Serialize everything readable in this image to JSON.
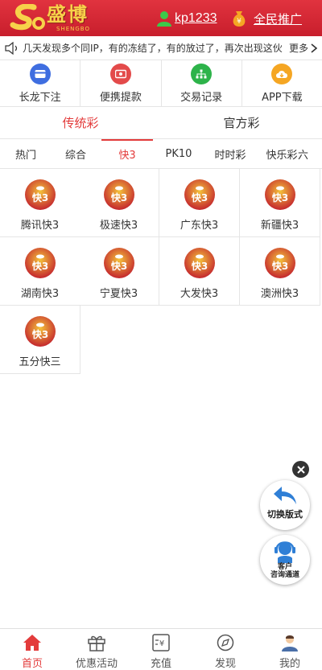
{
  "header": {
    "logo": {
      "brand": "盛博",
      "brand_sub": "SHENGBO"
    },
    "user": {
      "name": "kp1233"
    },
    "promo": {
      "label": "全民推广"
    }
  },
  "notice": {
    "text": "几天发现多个同IP，有的冻结了，有的放过了，再次出现这伙",
    "more_label": "更多"
  },
  "quick_actions": [
    {
      "label": "长龙下注",
      "icon": "wallet-icon",
      "color": "#3f6ee0"
    },
    {
      "label": "便携提款",
      "icon": "cash-icon",
      "color": "#e34a4a"
    },
    {
      "label": "交易记录",
      "icon": "network-icon",
      "color": "#2db34a"
    },
    {
      "label": "APP下载",
      "icon": "cloud-download-icon",
      "color": "#f5a623"
    }
  ],
  "main_tabs": [
    {
      "label": "传统彩"
    },
    {
      "label": "官方彩"
    }
  ],
  "sub_tabs": [
    {
      "label": "热门"
    },
    {
      "label": "综合"
    },
    {
      "label": "快3"
    },
    {
      "label": "PK10"
    },
    {
      "label": "时时彩"
    },
    {
      "label": "快乐彩"
    },
    {
      "label": "六"
    }
  ],
  "active_sub_tab": "快3",
  "games": [
    {
      "label": "腾讯快3"
    },
    {
      "label": "极速快3"
    },
    {
      "label": "广东快3"
    },
    {
      "label": "新疆快3"
    },
    {
      "label": "湖南快3"
    },
    {
      "label": "宁夏快3"
    },
    {
      "label": "大发快3"
    },
    {
      "label": "澳洲快3"
    },
    {
      "label": "五分快三"
    }
  ],
  "game_icon_text": "快3",
  "floating": {
    "switch_label": "切换版式",
    "service_line1": "客户",
    "service_line2": "咨询通道"
  },
  "bottom_nav": [
    {
      "label": "首页",
      "icon": "home-icon"
    },
    {
      "label": "优惠活动",
      "icon": "gift-icon"
    },
    {
      "label": "充值",
      "icon": "recharge-icon"
    },
    {
      "label": "发现",
      "icon": "compass-icon"
    },
    {
      "label": "我的",
      "icon": "profile-icon"
    }
  ],
  "colors": {
    "header_red": "#d4283a",
    "accent_red": "#e33b3b",
    "gold": "#f7d24a"
  }
}
